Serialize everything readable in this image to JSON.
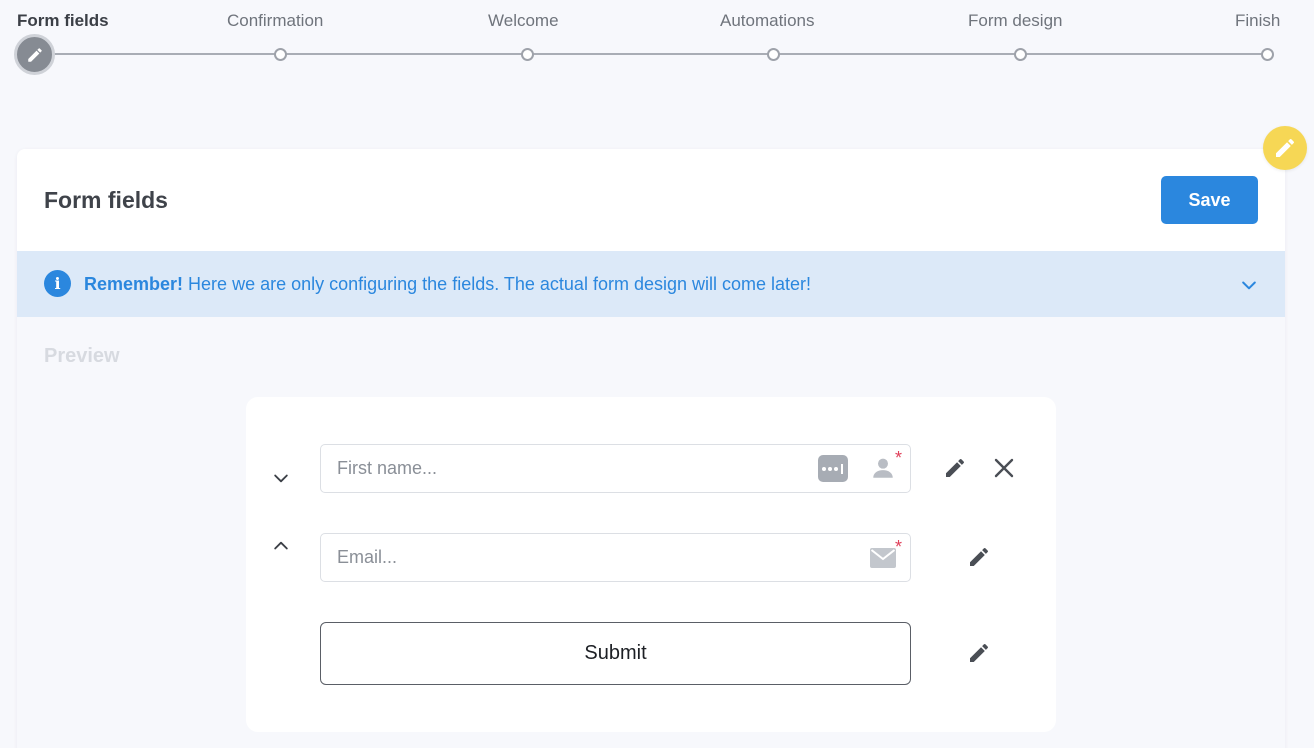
{
  "stepper": {
    "steps": [
      {
        "label": "Form fields",
        "active": true
      },
      {
        "label": "Confirmation",
        "active": false
      },
      {
        "label": "Welcome",
        "active": false
      },
      {
        "label": "Automations",
        "active": false
      },
      {
        "label": "Form design",
        "active": false
      },
      {
        "label": "Finish",
        "active": false
      }
    ]
  },
  "card": {
    "title": "Form fields",
    "save_label": "Save"
  },
  "info": {
    "strong": "Remember!",
    "text": " Here we are only configuring the fields. The actual form design will come later!",
    "icon": "i"
  },
  "preview": {
    "label": "Preview",
    "fields": [
      {
        "placeholder": "First name...",
        "required": true,
        "icons": [
          "password-dots-icon",
          "user-icon"
        ]
      },
      {
        "placeholder": "Email...",
        "required": true,
        "icons": [
          "envelope-icon"
        ]
      }
    ],
    "required_mark": "*",
    "submit_label": "Submit"
  },
  "colors": {
    "accent": "#2b87de",
    "info_bg": "#dce9f8",
    "highlight": "#f6d755",
    "required": "#e0405a"
  }
}
